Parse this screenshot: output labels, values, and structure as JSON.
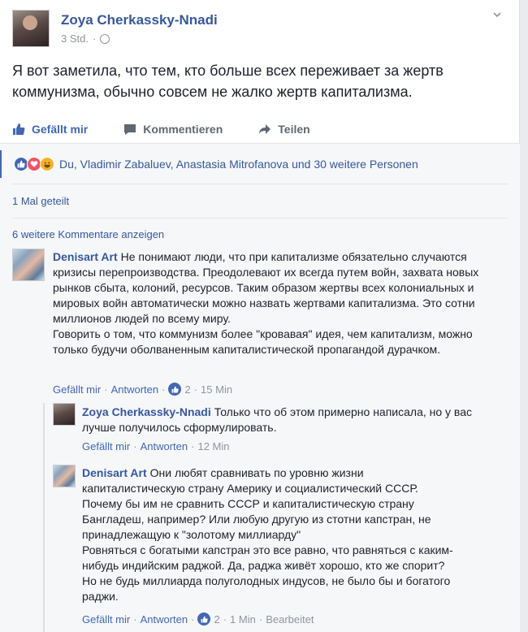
{
  "post": {
    "author": "Zoya Cherkassky-Nnadi",
    "time": "3 Std.",
    "text": "Я вот заметила, что тем, кто больше всех переживает за жертв коммунизма, обычно совсем не жалко жертв капитализма."
  },
  "actions": {
    "like": "Gefällt mir",
    "comment": "Kommentieren",
    "share": "Teilen"
  },
  "reactions": {
    "names": "Du, Vladimir Zabaluev, Anastasia Mitrofanova und 30 weitere Personen"
  },
  "shares": "1 Mal geteilt",
  "more_comments": "6 weitere Kommentare anzeigen",
  "comments": [
    {
      "author": "Denisart Art",
      "text": "Не понимают люди, что при капитализме обязательно случаются кризисы перепроизводства. Преодолевают их всегда путем войн, захвата новых рынков сбыта, колоний, ресурсов. Таким образом жертвы всех колониальных и мировых войн автоматически можно назвать жертвами капитализма. Это сотни миллионов людей по всему миру.\nГоворить о том, что коммунизм более \"кровавая\" идея, чем капитализм, можно только будучи оболваненным капиталистической пропагандой дурачком.",
      "like": "Gefällt mir",
      "reply": "Antworten",
      "count": "2",
      "time": "15 Min"
    },
    {
      "author": "Zoya Cherkassky-Nnadi",
      "text": "Только что об этом примерно написала, но у вас лучше получилось сформулировать.",
      "like": "Gefällt mir",
      "reply": "Antworten",
      "time": "12 Min"
    },
    {
      "author": "Denisart Art",
      "text": "Они любят сравнивать по уровню жизни капиталистическую страну Америку и социалистический СССР. Почему бы им не сравнить СССР и капиталистическую страну Бангладеш, например? Или любую другую из стотни капстран, не принадлежащую к \"золотому миллиарду\"\nРовняться с богатыми капстран это все равно, что равняться с каким-нибудь индийским раджой. Да, раджа живёт хорошо, кто же спорит? Но не будь миллиарда полуголодных индусов, не было бы и богатого раджи.",
      "like": "Gefällt mir",
      "reply": "Antworten",
      "count": "2",
      "time": "1 Min",
      "edited": "Bearbeitet"
    }
  ],
  "colors": {
    "link": "#365899",
    "accent": "#4267b2",
    "meta": "#90949c",
    "bg": "#f6f7f9"
  }
}
